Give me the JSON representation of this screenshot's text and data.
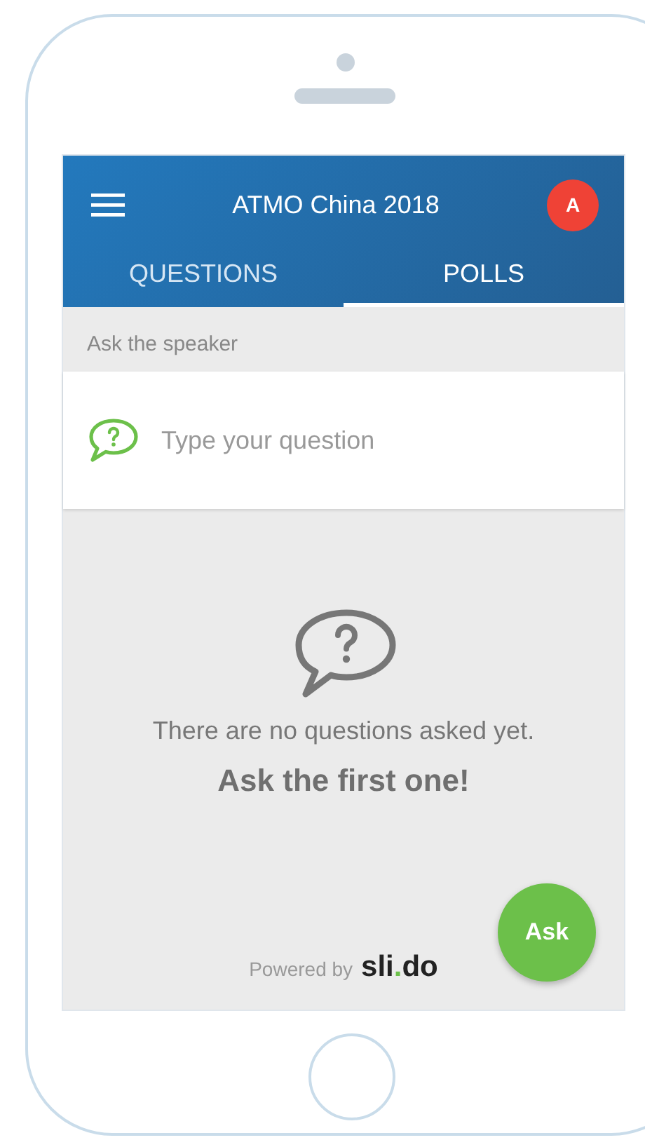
{
  "header": {
    "title": "ATMO China 2018",
    "avatar": "A"
  },
  "tabs": [
    {
      "label": "QUESTIONS",
      "selected": false
    },
    {
      "label": "POLLS",
      "selected": true
    }
  ],
  "section_label": "Ask the speaker",
  "question_field": {
    "placeholder": "Type your question"
  },
  "empty_state": {
    "message": "There are no questions asked yet.",
    "call_to_action": "Ask the first one!"
  },
  "ask_button": "Ask",
  "footer": {
    "powered_by": "Powered by",
    "logo": [
      {
        "text": "sli"
      },
      {
        "text": ".",
        "color": "#6cc04a"
      },
      {
        "text": "do"
      }
    ]
  }
}
